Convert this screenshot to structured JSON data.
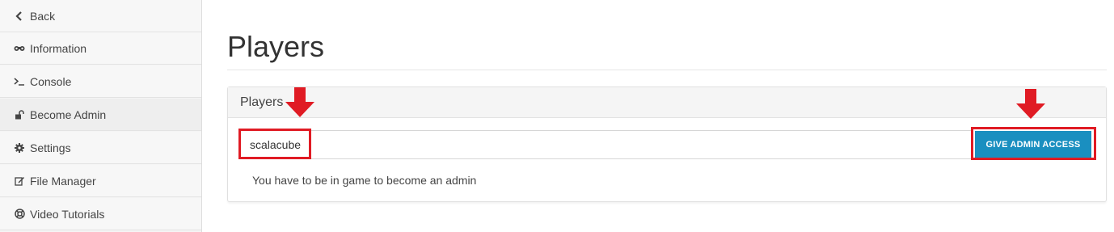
{
  "sidebar": {
    "items": [
      {
        "label": "Back",
        "icon": "chevron-left-icon"
      },
      {
        "label": "Information",
        "icon": "binoculars-icon"
      },
      {
        "label": "Console",
        "icon": "terminal-icon"
      },
      {
        "label": "Become Admin",
        "icon": "unlock-icon",
        "active": true
      },
      {
        "label": "Settings",
        "icon": "gear-icon"
      },
      {
        "label": "File Manager",
        "icon": "edit-icon"
      },
      {
        "label": "Video Tutorials",
        "icon": "life-ring-icon"
      }
    ]
  },
  "main": {
    "title": "Players",
    "panel": {
      "heading": "Players",
      "input_value": "scalacube",
      "button_label": "GIVE ADMIN ACCESS",
      "hint": "You have to be in game to become an admin"
    }
  },
  "colors": {
    "accent": "#1a8fc0",
    "annotation": "#e01b24"
  }
}
